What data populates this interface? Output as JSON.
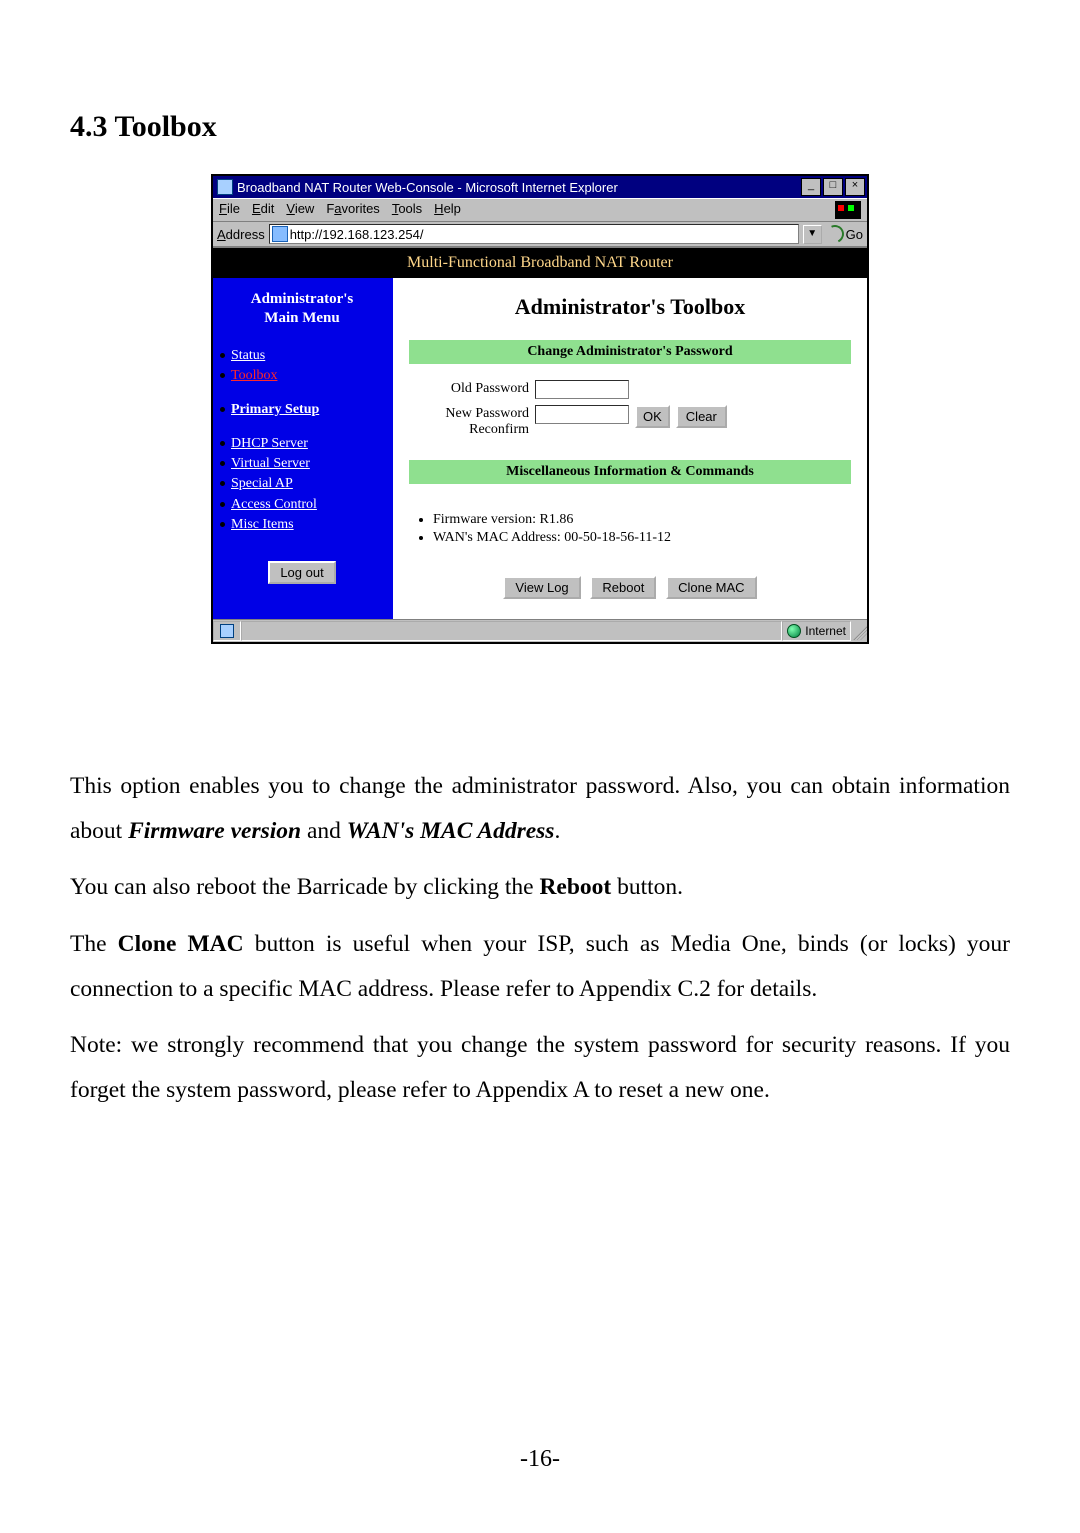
{
  "heading": "4.3 Toolbox",
  "ie": {
    "title": "Broadband NAT Router Web-Console - Microsoft Internet Explorer",
    "menu": {
      "file": "File",
      "edit": "Edit",
      "view": "View",
      "favorites": "Favorites",
      "tools": "Tools",
      "help": "Help"
    },
    "address_label": "Address",
    "url": "http://192.168.123.254/",
    "go": "Go",
    "banner": "Multi-Functional Broadband NAT Router",
    "status_zone": "Internet"
  },
  "sidebar": {
    "title_line1": "Administrator's",
    "title_line2": "Main Menu",
    "items": {
      "status": "Status",
      "toolbox": "Toolbox",
      "primary": "Primary Setup",
      "dhcp": "DHCP Server",
      "virtual": "Virtual Server",
      "special": "Special AP",
      "access": "Access Control",
      "misc": "Misc Items"
    },
    "logout": "Log out"
  },
  "main": {
    "title": "Administrator's Toolbox",
    "pw_header": "Change Administrator's Password",
    "old_pw": "Old Password",
    "new_pw": "New Password",
    "reconfirm": "Reconfirm",
    "ok": "OK",
    "clear": "Clear",
    "misc_header": "Miscellaneous Information & Commands",
    "firmware": "Firmware version: R1.86",
    "mac": "WAN's MAC Address: 00-50-18-56-11-12",
    "view_log": "View Log",
    "reboot": "Reboot",
    "clone_mac": "Clone MAC"
  },
  "para": {
    "p1a": "This option enables you to change the administrator password. Also, you can obtain information about ",
    "p1b": "Firmware version",
    "p1c": " and ",
    "p1d": "WAN's MAC Address",
    "p1e": ".",
    "p2a": "You can also reboot the Barricade by clicking the ",
    "p2b": "Reboot",
    "p2c": " button.",
    "p3a": "The ",
    "p3b": "Clone MAC",
    "p3c": " button is useful when your ISP, such as Media One, binds  (or locks) your connection to a specific MAC address. Please refer to Appendix C.2 for details.",
    "p4": "Note: we strongly recommend that you change the system password for security reasons. If you forget the system password, please refer to Appendix A to reset a new one."
  },
  "page_number": "-16-"
}
